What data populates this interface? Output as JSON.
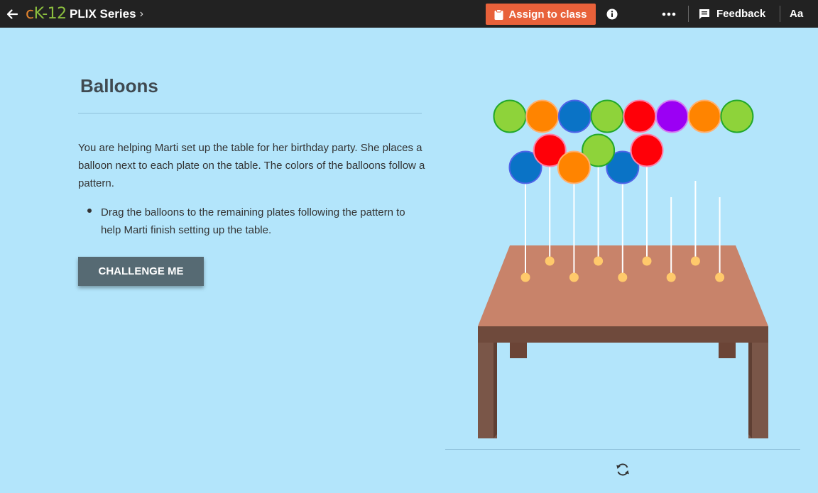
{
  "topbar": {
    "back_icon": "arrow-left-icon",
    "logo": {
      "c": "c",
      "k12": "K-12"
    },
    "series_label": "PLIX Series",
    "chevron": "›",
    "assign_label": "Assign to class",
    "assign_icon": "clipboard-icon",
    "info_icon": "info-icon",
    "more_icon": "more-dots-icon",
    "feedback_label": "Feedback",
    "feedback_icon": "feedback-icon",
    "font_size_label": "Aa"
  },
  "content": {
    "title": "Balloons",
    "paragraph": "You are helping Marti set up the table for her birthday party. She places a balloon next to each plate on the table. The colors of the balloons follow a pattern.",
    "bullet": "Drag the balloons to the remaining plates following the pattern to help Marti finish setting up the table.",
    "challenge_label": "CHALLENGE ME"
  },
  "interactive": {
    "balloon_bank": [
      "green",
      "orange",
      "blue",
      "green",
      "red",
      "purple",
      "orange",
      "green"
    ],
    "placed_balloons": [
      "blue",
      "red",
      "orange",
      "green",
      "blue",
      "red"
    ],
    "empty_plates": 3,
    "colors": {
      "green": "#8ed33a",
      "orange": "#ff8400",
      "blue": "#0a73c6",
      "red": "#ff0008",
      "purple": "#9b00f4",
      "green_stroke": "#22a82a",
      "orange_stroke": "#ffb070",
      "blue_stroke": "#4f63e8",
      "red_stroke": "#ff7fa8",
      "purple_stroke": "#d47ff0",
      "table_top": "#c8836a",
      "table_apron": "#6f4a3c",
      "table_leg": "#7a5648",
      "plate": "#ffc96b",
      "background": "#b3e5fb"
    },
    "reset_icon": "refresh-icon"
  }
}
